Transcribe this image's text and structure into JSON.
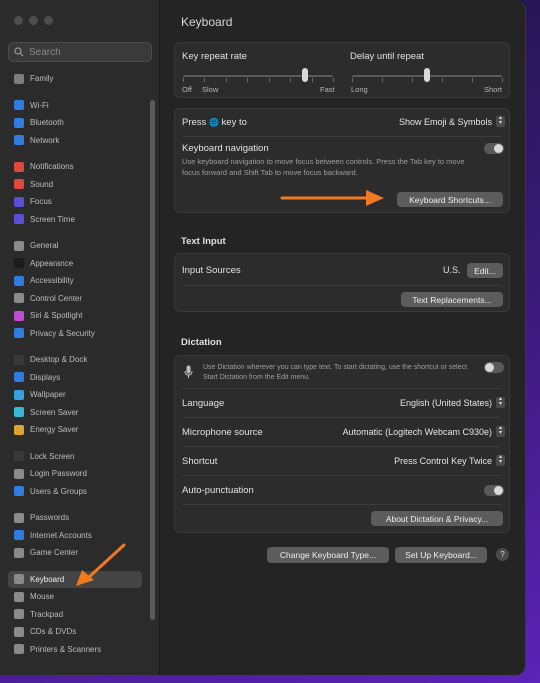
{
  "sidebar": {
    "search_placeholder": "Search",
    "groups": [
      [
        {
          "label": "Family",
          "color": "#7d7d7d"
        }
      ],
      [
        {
          "label": "Wi-Fi",
          "color": "#2f7de1"
        },
        {
          "label": "Bluetooth",
          "color": "#2f7de1"
        },
        {
          "label": "Network",
          "color": "#2f7de1"
        }
      ],
      [
        {
          "label": "Notifications",
          "color": "#e0483d"
        },
        {
          "label": "Sound",
          "color": "#e0483d"
        },
        {
          "label": "Focus",
          "color": "#5a4fd6"
        },
        {
          "label": "Screen Time",
          "color": "#5a4fd6"
        }
      ],
      [
        {
          "label": "General",
          "color": "#8a8a8a"
        },
        {
          "label": "Appearance",
          "color": "#1c1c1c"
        },
        {
          "label": "Accessibility",
          "color": "#2f7de1"
        },
        {
          "label": "Control Center",
          "color": "#8a8a8a"
        },
        {
          "label": "Siri & Spotlight",
          "color": "#c04cd6"
        },
        {
          "label": "Privacy & Security",
          "color": "#2f7de1"
        }
      ],
      [
        {
          "label": "Desktop & Dock",
          "color": "#3a3a3a"
        },
        {
          "label": "Displays",
          "color": "#2f7de1"
        },
        {
          "label": "Wallpaper",
          "color": "#35a3e0"
        },
        {
          "label": "Screen Saver",
          "color": "#35b9d6"
        },
        {
          "label": "Energy Saver",
          "color": "#e0a32f"
        }
      ],
      [
        {
          "label": "Lock Screen",
          "color": "#3a3a3a"
        },
        {
          "label": "Login Password",
          "color": "#8a8a8a"
        },
        {
          "label": "Users & Groups",
          "color": "#2f7de1"
        }
      ],
      [
        {
          "label": "Passwords",
          "color": "#8a8a8a"
        },
        {
          "label": "Internet Accounts",
          "color": "#2f7de1"
        },
        {
          "label": "Game Center",
          "color": "#8a8a8a"
        }
      ],
      [
        {
          "label": "Keyboard",
          "color": "#8a8a8a",
          "selected": true
        },
        {
          "label": "Mouse",
          "color": "#8a8a8a"
        },
        {
          "label": "Trackpad",
          "color": "#8a8a8a"
        },
        {
          "label": "CDs & DVDs",
          "color": "#8a8a8a"
        },
        {
          "label": "Printers & Scanners",
          "color": "#8a8a8a"
        }
      ]
    ]
  },
  "main": {
    "title": "Keyboard",
    "key_repeat": {
      "label": "Key repeat rate",
      "left": "Off",
      "left2": "Slow",
      "right": "Fast",
      "level": 0.81
    },
    "delay_repeat": {
      "label": "Delay until repeat",
      "left": "Long",
      "right": "Short",
      "level": 0.5
    },
    "press_key": {
      "label_pre": "Press",
      "globe": "🌐",
      "label_post": "key to",
      "value": "Show Emoji & Symbols"
    },
    "keyboard_nav": {
      "label": "Keyboard navigation",
      "desc": "Use keyboard navigation to move focus between controls. Press the Tab key to move focus forward and Shift Tab to move focus backward.",
      "on": false
    },
    "shortcuts_button": "Keyboard Shortcuts...",
    "text_input": {
      "heading": "Text Input",
      "input_sources_label": "Input Sources",
      "input_sources_value": "U.S.",
      "edit_button": "Edit...",
      "replacements_button": "Text Replacements..."
    },
    "dictation": {
      "heading": "Dictation",
      "desc": "Use Dictation wherever you can type text. To start dictating, use the shortcut or select Start Dictation from the Edit menu.",
      "on": false,
      "language_label": "Language",
      "language_value": "English (United States)",
      "mic_label": "Microphone source",
      "mic_value": "Automatic (Logitech Webcam C930e)",
      "shortcut_label": "Shortcut",
      "shortcut_value": "Press Control Key Twice",
      "autopunct_label": "Auto-punctuation",
      "autopunct_on": false,
      "about_button": "About Dictation & Privacy..."
    },
    "change_type_button": "Change Keyboard Type...",
    "setup_button": "Set Up Keyboard...",
    "help_label": "?"
  },
  "colors": {
    "arrow": "#f07a1f",
    "accent": "#2f7de1"
  }
}
